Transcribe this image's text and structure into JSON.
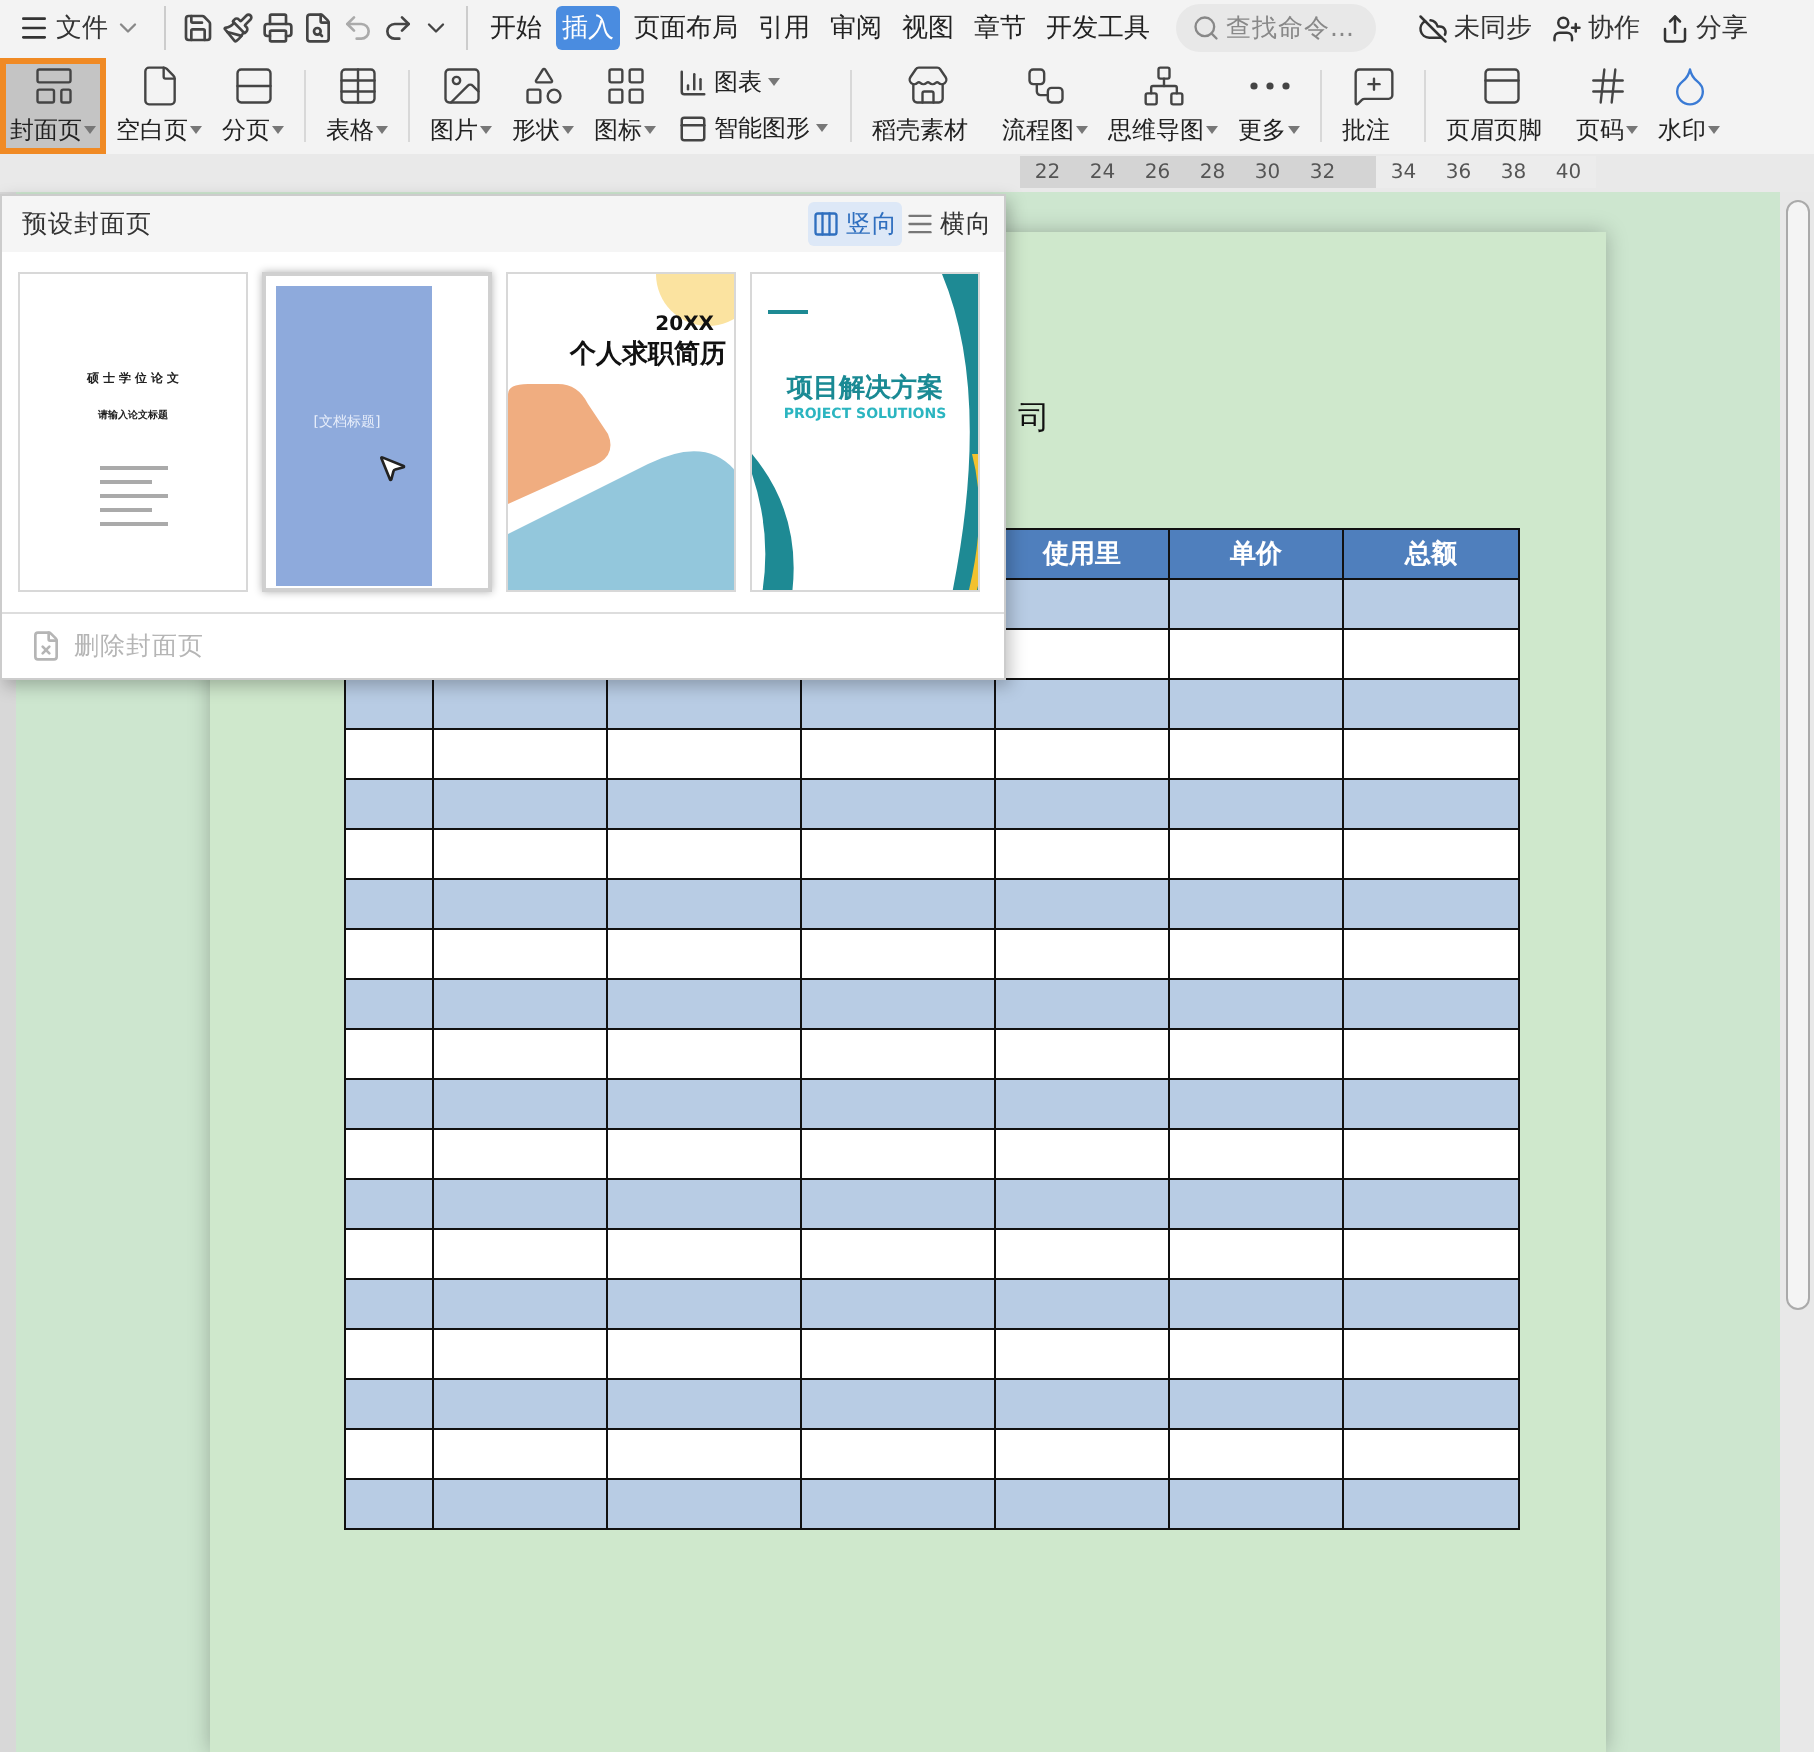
{
  "menu": {
    "label": "文件"
  },
  "tabs": [
    {
      "label": "开始",
      "selected": false
    },
    {
      "label": "插入",
      "selected": true
    },
    {
      "label": "页面布局",
      "selected": false
    },
    {
      "label": "引用",
      "selected": false
    },
    {
      "label": "审阅",
      "selected": false
    },
    {
      "label": "视图",
      "selected": false
    },
    {
      "label": "章节",
      "selected": false
    },
    {
      "label": "开发工具",
      "selected": false
    }
  ],
  "search": {
    "placeholder": "查找命令..."
  },
  "top_actions": [
    {
      "label": "未同步"
    },
    {
      "label": "协作"
    },
    {
      "label": "分享"
    }
  ],
  "ribbon": [
    {
      "label": "封面页",
      "dropdown": true,
      "selected": true
    },
    {
      "label": "空白页",
      "dropdown": true,
      "selected": false
    },
    {
      "label": "分页",
      "dropdown": true,
      "selected": false
    },
    {
      "label": "表格",
      "dropdown": true,
      "selected": false
    },
    {
      "label": "图片",
      "dropdown": true,
      "selected": false
    },
    {
      "label": "形状",
      "dropdown": true,
      "selected": false
    },
    {
      "label": "图标",
      "dropdown": true,
      "selected": false
    },
    {
      "label": "图表",
      "dropdown": true,
      "selected": false
    },
    {
      "label": "智能图形",
      "dropdown": true,
      "selected": false
    },
    {
      "label": "稻壳素材",
      "dropdown": false,
      "selected": false
    },
    {
      "label": "流程图",
      "dropdown": true,
      "selected": false
    },
    {
      "label": "思维导图",
      "dropdown": true,
      "selected": false
    },
    {
      "label": "更多",
      "dropdown": true,
      "selected": false
    },
    {
      "label": "批注",
      "dropdown": false,
      "selected": false
    },
    {
      "label": "页眉页脚",
      "dropdown": false,
      "selected": false
    },
    {
      "label": "页码",
      "dropdown": true,
      "selected": false
    },
    {
      "label": "水印",
      "dropdown": true,
      "selected": false
    }
  ],
  "ruler": [
    "22",
    "24",
    "26",
    "28",
    "30",
    "32",
    "34",
    "36",
    "38",
    "40"
  ],
  "cover_panel": {
    "title": "预设封面页",
    "orientations": [
      {
        "label": "竖向",
        "selected": true
      },
      {
        "label": "横向",
        "selected": false
      }
    ],
    "templates": [
      {
        "kind": "thesis",
        "title": "硕 士 学 位 论 文",
        "subtitle": "请输入论文标题",
        "selected": false
      },
      {
        "kind": "blue",
        "title": "[文档标题]",
        "selected": true
      },
      {
        "kind": "resume",
        "year": "20XX",
        "title": "个人求职简历",
        "selected": false
      },
      {
        "kind": "project",
        "title": "项目解决方案",
        "subtitle": "PROJECT SOLUTIONS",
        "selected": false
      }
    ],
    "delete": {
      "label": "删除封面页",
      "disabled": true
    }
  },
  "document": {
    "title_tail": "司",
    "table": {
      "columns": [
        {
          "label": "使用里"
        },
        {
          "label": "单价"
        },
        {
          "label": "总额"
        }
      ],
      "rows": [
        {
          "shaded": true
        },
        {
          "shaded": false
        },
        {
          "shaded": true
        },
        {
          "shaded": false
        },
        {
          "shaded": true
        },
        {
          "shaded": false
        },
        {
          "shaded": true
        },
        {
          "shaded": false
        },
        {
          "shaded": true
        },
        {
          "shaded": false
        },
        {
          "shaded": true
        },
        {
          "shaded": false
        },
        {
          "shaded": true
        },
        {
          "shaded": false
        },
        {
          "shaded": true
        },
        {
          "shaded": false
        },
        {
          "shaded": true
        },
        {
          "shaded": false
        },
        {
          "shaded": true
        }
      ]
    }
  }
}
